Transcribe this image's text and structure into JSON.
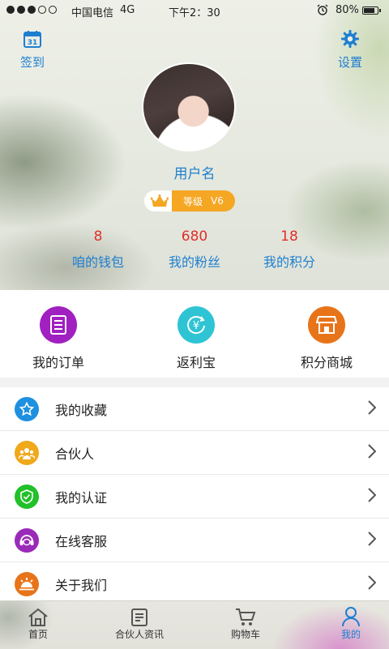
{
  "status_bar": {
    "carrier": "中国电信",
    "network": "4G",
    "time": "下午2：30",
    "battery": "80%",
    "battery_level": 0.8,
    "signal_bars_filled": 3,
    "signal_bars_total": 5
  },
  "header": {
    "checkin_label": "签到",
    "checkin_icon_day": "31",
    "settings_label": "设置",
    "username": "用户名",
    "level_label": "等级",
    "level_value": "V6",
    "stats": [
      {
        "value": "8",
        "label": "咱的钱包"
      },
      {
        "value": "680",
        "label": "我的粉丝"
      },
      {
        "value": "18",
        "label": "我的积分"
      }
    ]
  },
  "quick_actions": [
    {
      "label": "我的订单",
      "icon": "order-icon",
      "color": "#a020c0"
    },
    {
      "label": "返利宝",
      "icon": "rebate-icon",
      "color": "#2fc4d4"
    },
    {
      "label": "积分商城",
      "icon": "store-icon",
      "color": "#e8741a"
    }
  ],
  "menu": [
    {
      "label": "我的收藏",
      "icon": "star-icon",
      "color": "#1e90e0"
    },
    {
      "label": "合伙人",
      "icon": "partner-icon",
      "color": "#f0a81c"
    },
    {
      "label": "我的认证",
      "icon": "shield-icon",
      "color": "#22c02a"
    },
    {
      "label": "在线客服",
      "icon": "headset-icon",
      "color": "#9a2ab8"
    },
    {
      "label": "关于我们",
      "icon": "info-icon",
      "color": "#e8741a"
    }
  ],
  "tabs": [
    {
      "label": "首页",
      "icon": "home-icon"
    },
    {
      "label": "合伙人资讯",
      "icon": "news-icon"
    },
    {
      "label": "购物车",
      "icon": "cart-icon"
    },
    {
      "label": "我的",
      "icon": "user-icon",
      "active": true
    }
  ],
  "colors": {
    "accent": "#1e7fd0",
    "stat_number": "#e0302a",
    "level_pill": "#f5a623"
  }
}
